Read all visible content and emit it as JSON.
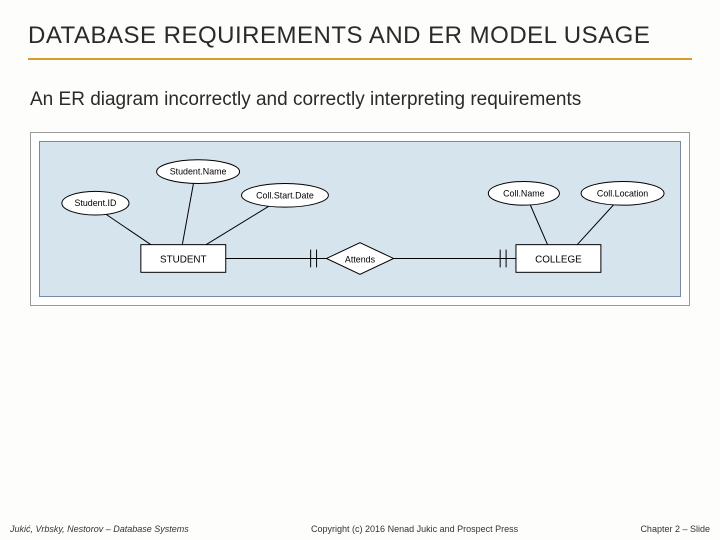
{
  "slide": {
    "title": "DATABASE REQUIREMENTS AND ER MODEL USAGE",
    "subtitle": "An ER diagram incorrectly and correctly interpreting requirements"
  },
  "diagram": {
    "entities": {
      "student": "STUDENT",
      "college": "COLLEGE"
    },
    "relationship": "Attends",
    "attributes": {
      "student_id": "Student.ID",
      "student_name": "Student.Name",
      "coll_start_date": "Coll.Start.Date",
      "coll_name": "Coll.Name",
      "coll_location": "Coll.Location"
    }
  },
  "footer": {
    "authors": "Jukić, Vrbsky, Nestorov – Database Systems",
    "copyright": "Copyright (c) 2016 Nenad Jukic and Prospect Press",
    "chapter": "Chapter 2 – Slide"
  }
}
